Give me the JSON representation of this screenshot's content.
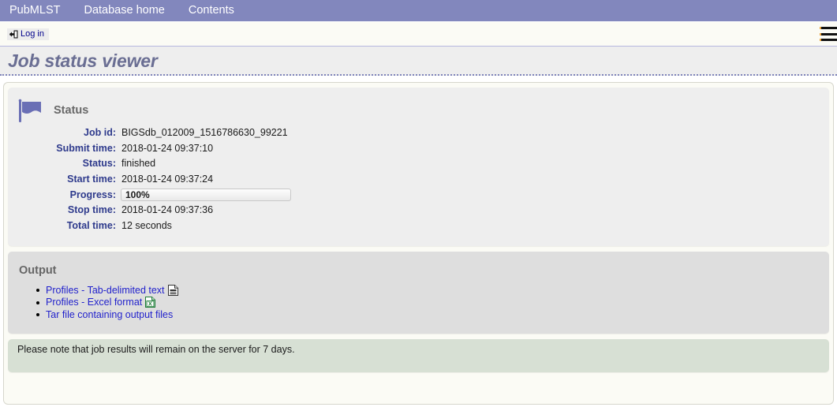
{
  "nav": {
    "items": [
      {
        "label": "PubMLST",
        "name": "nav-item-pubmlst"
      },
      {
        "label": "Database home",
        "name": "nav-item-database-home"
      },
      {
        "label": "Contents",
        "name": "nav-item-contents"
      }
    ]
  },
  "utilbar": {
    "login_label": "Log in",
    "login_icon": "login-arrow-icon",
    "menu_icon": "hamburger-menu-icon"
  },
  "page": {
    "title": "Job status viewer"
  },
  "status": {
    "heading": "Status",
    "icon": "flag-icon",
    "fields": [
      {
        "label": "Job id:",
        "value": "BIGSdb_012009_1516786630_99221"
      },
      {
        "label": "Submit time:",
        "value": "2018-01-24 09:37:10"
      },
      {
        "label": "Status:",
        "value": "finished"
      },
      {
        "label": "Start time:",
        "value": "2018-01-24 09:37:24"
      },
      {
        "label": "Stop time:",
        "value": "2018-01-24 09:37:36"
      },
      {
        "label": "Total time:",
        "value": "12 seconds"
      }
    ],
    "progress": {
      "label": "Progress:",
      "value": "100%",
      "percent": 100
    }
  },
  "output": {
    "heading": "Output",
    "links": [
      {
        "label": "Profiles - Tab-delimited text",
        "icon": "text-file-icon"
      },
      {
        "label": "Profiles - Excel format",
        "icon": "excel-file-icon"
      },
      {
        "label": "Tar file containing output files",
        "icon": "none"
      }
    ]
  },
  "notice": {
    "text": "Please note that job results will remain on the server for 7 days."
  },
  "colors": {
    "nav_background": "#8287bd",
    "title_text": "#6a6e93",
    "label_text": "#2e3a8c",
    "link_text": "#2222cc",
    "status_panel": "#eeeeee",
    "output_panel": "#dedede",
    "notice_panel": "#d7e0d4",
    "flag_icon": "#6a6fb5"
  }
}
